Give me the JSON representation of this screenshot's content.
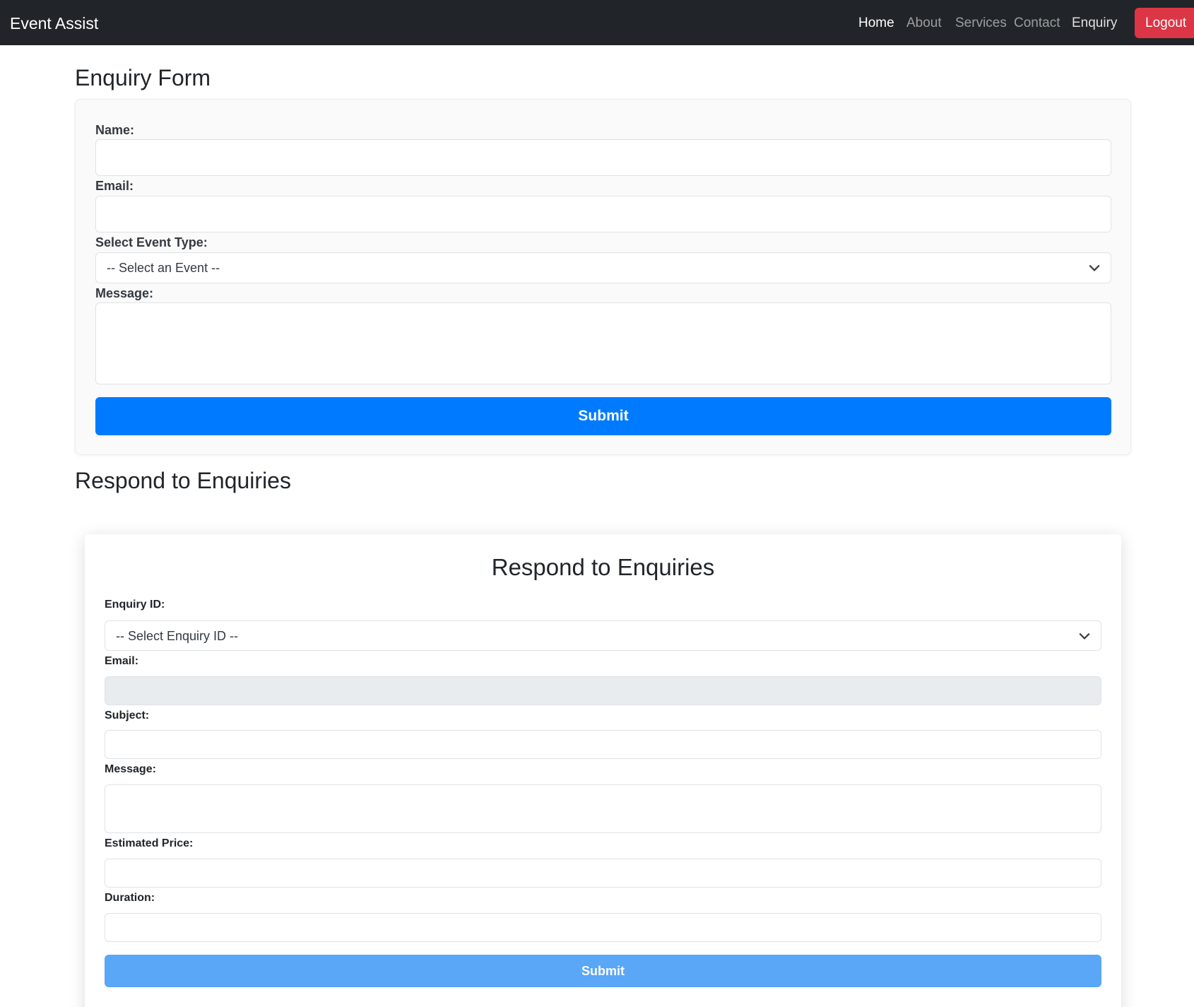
{
  "navbar": {
    "brand": "Event Assist",
    "items": [
      {
        "label": "Home"
      },
      {
        "label": "About"
      },
      {
        "label": "Services"
      },
      {
        "label": "Contact"
      },
      {
        "label": "Enquiry"
      }
    ],
    "logout_label": "Logout",
    "colors": {
      "background": "#212529",
      "logout": "#dc3545"
    }
  },
  "enquiry_form": {
    "heading": "Enquiry Form",
    "name_label": "Name:",
    "name_value": "",
    "email_label": "Email:",
    "email_value": "",
    "event_type_label": "Select Event Type:",
    "event_type_selected": "-- Select an Event --",
    "message_label": "Message:",
    "message_value": "",
    "submit_label": "Submit",
    "submit_color": "#007bff"
  },
  "respond": {
    "section_heading": "Respond to Enquiries",
    "card_title": "Respond to Enquiries",
    "enquiry_id_label": "Enquiry ID:",
    "enquiry_id_selected": "-- Select Enquiry ID --",
    "email_label": "Email:",
    "email_value": "",
    "subject_label": "Subject:",
    "subject_value": "",
    "message_label": "Message:",
    "message_value": "",
    "price_label": "Estimated Price:",
    "price_value": "",
    "duration_label": "Duration:",
    "duration_value": "",
    "submit_label": "Submit",
    "submit_color": "#5aa6f7"
  }
}
